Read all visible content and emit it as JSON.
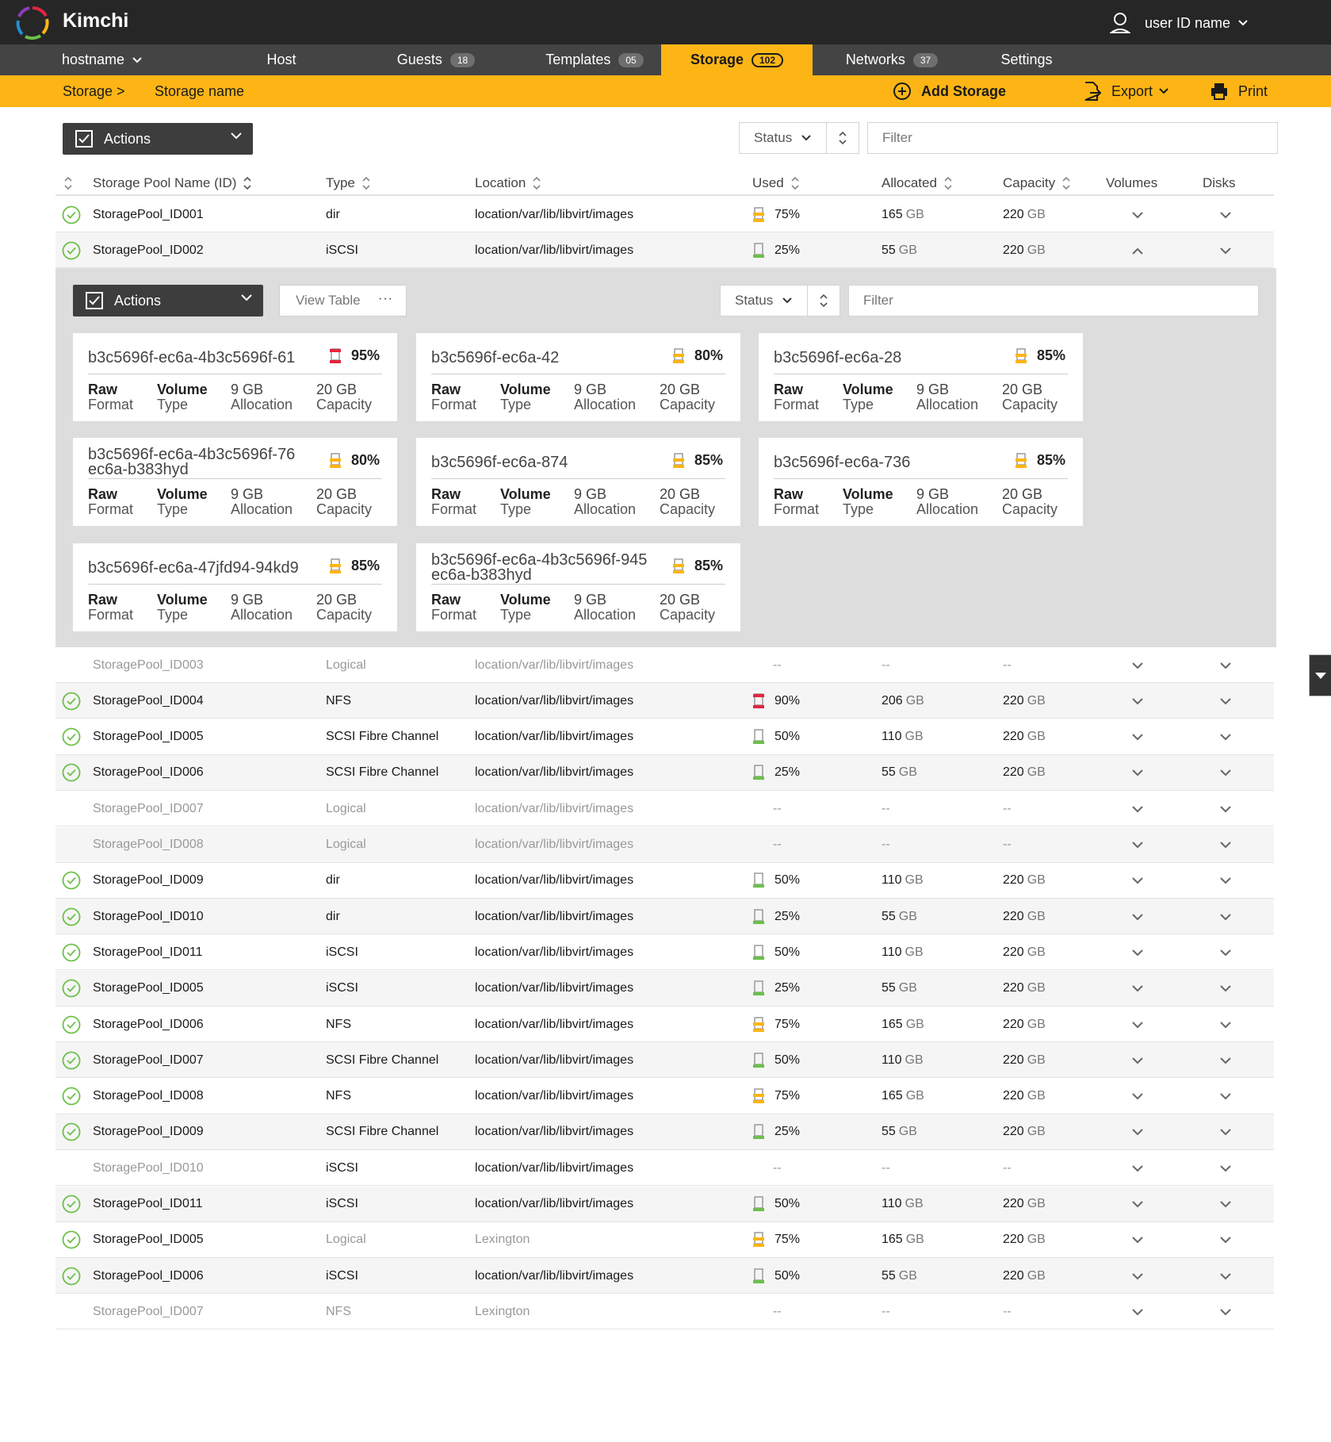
{
  "app": {
    "brand": "Kimchi",
    "user_name": "user ID name",
    "icons": {
      "logo": "kimchi-logo-icon",
      "user": "user-icon",
      "chevron": "chevron-down-icon"
    }
  },
  "nav": {
    "hostname": "hostname",
    "items": [
      {
        "label": "Host",
        "badge": ""
      },
      {
        "label": "Guests",
        "badge": "18"
      },
      {
        "label": "Templates",
        "badge": "05"
      },
      {
        "label": "Storage",
        "badge": "102"
      },
      {
        "label": "Networks",
        "badge": "37"
      },
      {
        "label": "Settings",
        "badge": ""
      }
    ],
    "active": "Storage",
    "accent_color": "#fdb515"
  },
  "breadcrumb": {
    "root": "Storage >",
    "current": "Storage name",
    "add_storage": "Add Storage",
    "export": "Export",
    "print": "Print"
  },
  "toolbar": {
    "actions_label": "Actions",
    "status_label": "Status",
    "filter_placeholder": "Filter"
  },
  "table": {
    "headers": {
      "name": "Storage Pool Name (ID)",
      "type": "Type",
      "location": "Location",
      "used": "Used",
      "allocated": "Allocated",
      "capacity": "Capacity",
      "volumes": "Volumes",
      "disks": "Disks"
    },
    "rows": [
      {
        "active": true,
        "name": "StoragePool_ID001",
        "type": "dir",
        "location": "location/var/lib/libvirt/images",
        "used": "75%",
        "used_level": 0.75,
        "allocated": "165",
        "capacity": "220",
        "expanded": false
      },
      {
        "active": true,
        "name": "StoragePool_ID002",
        "type": "iSCSI",
        "location": "location/var/lib/libvirt/images",
        "used": "25%",
        "used_level": 0.25,
        "allocated": "55",
        "capacity": "220",
        "expanded": true
      },
      {
        "active": false,
        "name": "StoragePool_ID003",
        "type": "Logical",
        "location": "location/var/lib/libvirt/images",
        "used": "--",
        "allocated": "--",
        "capacity": "--"
      },
      {
        "active": true,
        "name": "StoragePool_ID004",
        "type": "NFS",
        "location": "location/var/lib/libvirt/images",
        "used": "90%",
        "used_level": 0.9,
        "allocated": "206",
        "capacity": "220"
      },
      {
        "active": true,
        "name": "StoragePool_ID005",
        "type": "SCSI Fibre Channel",
        "location": "location/var/lib/libvirt/images",
        "used": "50%",
        "used_level": 0.5,
        "allocated": "110",
        "capacity": "220"
      },
      {
        "active": true,
        "name": "StoragePool_ID006",
        "type": "SCSI Fibre Channel",
        "location": "location/var/lib/libvirt/images",
        "used": "25%",
        "used_level": 0.25,
        "allocated": "55",
        "capacity": "220"
      },
      {
        "active": false,
        "name": "StoragePool_ID007",
        "type": "Logical",
        "location": "location/var/lib/libvirt/images",
        "used": "--",
        "allocated": "--",
        "capacity": "--"
      },
      {
        "active": false,
        "name": "StoragePool_ID008",
        "type": "Logical",
        "location": "location/var/lib/libvirt/images",
        "used": "--",
        "allocated": "--",
        "capacity": "--"
      },
      {
        "active": true,
        "name": "StoragePool_ID009",
        "type": "dir",
        "location": "location/var/lib/libvirt/images",
        "used": "50%",
        "used_level": 0.5,
        "allocated": "110",
        "capacity": "220"
      },
      {
        "active": true,
        "name": "StoragePool_ID010",
        "type": "dir",
        "location": "location/var/lib/libvirt/images",
        "used": "25%",
        "used_level": 0.25,
        "allocated": "55",
        "capacity": "220"
      },
      {
        "active": true,
        "name": "StoragePool_ID011",
        "type": "iSCSI",
        "location": "location/var/lib/libvirt/images",
        "used": "50%",
        "used_level": 0.5,
        "allocated": "110",
        "capacity": "220"
      },
      {
        "active": true,
        "name": "StoragePool_ID005",
        "type": "iSCSI",
        "location": "location/var/lib/libvirt/images",
        "used": "25%",
        "used_level": 0.25,
        "allocated": "55",
        "capacity": "220"
      },
      {
        "active": true,
        "name": "StoragePool_ID006",
        "type": "NFS",
        "location": "location/var/lib/libvirt/images",
        "used": "75%",
        "used_level": 0.75,
        "allocated": "165",
        "capacity": "220"
      },
      {
        "active": true,
        "name": "StoragePool_ID007",
        "type": "SCSI Fibre Channel",
        "location": "location/var/lib/libvirt/images",
        "used": "50%",
        "used_level": 0.5,
        "allocated": "110",
        "capacity": "220"
      },
      {
        "active": true,
        "name": "StoragePool_ID008",
        "type": "NFS",
        "location": "location/var/lib/libvirt/images",
        "used": "75%",
        "used_level": 0.75,
        "allocated": "165",
        "capacity": "220"
      },
      {
        "active": true,
        "name": "StoragePool_ID009",
        "type": "SCSI Fibre Channel",
        "location": "location/var/lib/libvirt/images",
        "used": "25%",
        "used_level": 0.25,
        "allocated": "55",
        "capacity": "220"
      },
      {
        "active": false,
        "name": "StoragePool_ID010",
        "type": "iSCSI",
        "location": "location/var/lib/libvirt/images",
        "used": "--",
        "allocated": "--",
        "capacity": "--",
        "dark_text": true
      },
      {
        "active": true,
        "name": "StoragePool_ID011",
        "type": "iSCSI",
        "location": "location/var/lib/libvirt/images",
        "used": "50%",
        "used_level": 0.5,
        "allocated": "110",
        "capacity": "220"
      },
      {
        "active": true,
        "name": "StoragePool_ID005",
        "type": "Logical",
        "location": "Lexington",
        "used": "75%",
        "used_level": 0.75,
        "allocated": "165",
        "capacity": "220",
        "muted_type_loc": true
      },
      {
        "active": true,
        "name": "StoragePool_ID006",
        "type": "iSCSI",
        "location": "location/var/lib/libvirt/images",
        "used": "50%",
        "used_level": 0.5,
        "allocated": "55",
        "capacity": "220"
      },
      {
        "active": false,
        "name": "StoragePool_ID007",
        "type": "NFS",
        "location": "Lexington",
        "used": "--",
        "allocated": "--",
        "capacity": "--"
      }
    ],
    "unit": "GB"
  },
  "volumes_panel": {
    "actions_label": "Actions",
    "view_table_label": "View Table",
    "status_label": "Status",
    "filter_placeholder": "Filter",
    "meta_labels": {
      "format_top": "Raw",
      "format_bottom": "Format",
      "type_top": "Volume",
      "type_bottom": "Type",
      "alloc_top": "9 GB",
      "alloc_bottom": "Allocation",
      "cap_top": "20 GB",
      "cap_bottom": "Capacity"
    },
    "cards": [
      {
        "title": "b3c5696f-ec6a-4b3c5696f-61",
        "pct": "95%",
        "level": 0.95
      },
      {
        "title": "b3c5696f-ec6a-42",
        "pct": "80%",
        "level": 0.8
      },
      {
        "title": "b3c5696f-ec6a-28",
        "pct": "85%",
        "level": 0.85
      },
      {
        "title": "b3c5696f-ec6a-4b3c5696f-76 ec6a-b383hyd",
        "pct": "80%",
        "level": 0.8
      },
      {
        "title": "b3c5696f-ec6a-874",
        "pct": "85%",
        "level": 0.85
      },
      {
        "title": "b3c5696f-ec6a-736",
        "pct": "85%",
        "level": 0.85
      },
      {
        "title": "b3c5696f-ec6a-47jfd94-94kd9",
        "pct": "85%",
        "level": 0.85
      },
      {
        "title": "b3c5696f-ec6a-4b3c5696f-945 ec6a-b383hyd",
        "pct": "85%",
        "level": 0.85
      }
    ]
  },
  "colors": {
    "ok": "#6cc04a",
    "warn": "#fdb515",
    "critical": "#e3253f",
    "dark": "#262626"
  }
}
